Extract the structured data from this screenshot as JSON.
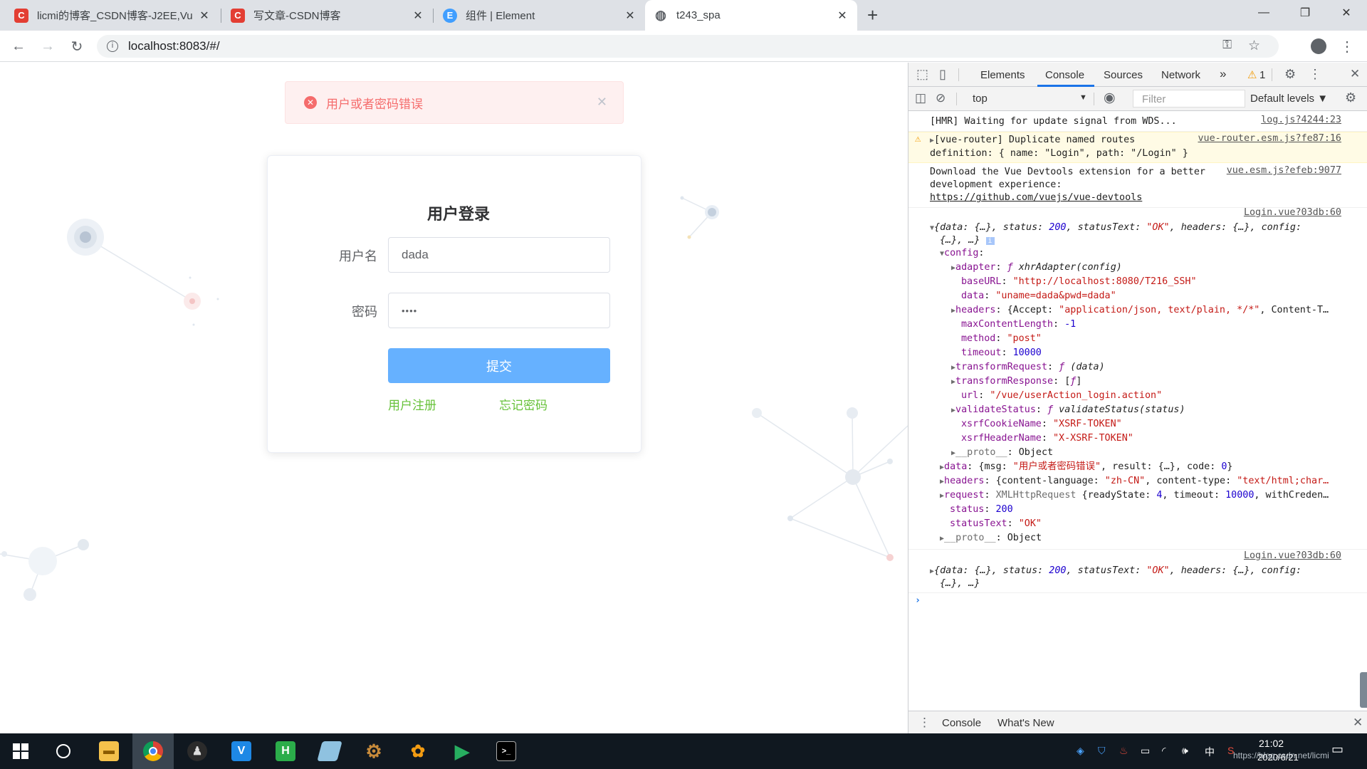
{
  "browser": {
    "tabs": [
      {
        "title": "licmi的博客_CSDN博客-J2EE,Vu",
        "favicon": "csdn-icon",
        "color": "#e33e33"
      },
      {
        "title": "写文章-CSDN博客",
        "favicon": "csdn-icon",
        "color": "#e33e33"
      },
      {
        "title": "组件 | Element",
        "favicon": "element-icon",
        "color": "#409eff"
      },
      {
        "title": "t243_spa",
        "favicon": "globe-icon",
        "color": "#5f6368"
      }
    ],
    "new_tab": "+",
    "address": "localhost:8083/#/"
  },
  "page": {
    "alert": {
      "message": "用户或者密码错误",
      "type": "error"
    },
    "login": {
      "title": "用户登录",
      "username_label": "用户名",
      "username_value": "dada",
      "password_label": "密码",
      "password_value": "••••",
      "submit": "提交",
      "register_link": "用户注册",
      "forgot_link": "忘记密码"
    }
  },
  "devtools": {
    "tabs": [
      "Elements",
      "Console",
      "Sources",
      "Network"
    ],
    "active_tab": "Console",
    "more": "»",
    "warning_count": "1",
    "context": "top",
    "filter_placeholder": "Filter",
    "levels": "Default levels ▼",
    "logs": {
      "hmr": "[HMR] Waiting for update signal from WDS...",
      "hmr_src": "log.js?4244:23",
      "warn1": "[vue-router] Duplicate named routes",
      "warn2": "definition: { name: \"Login\", path: \"/Login\" }",
      "warn_src": "vue-router.esm.js?fe87:16",
      "dev1": "Download the Vue Devtools extension for a better",
      "dev2": "development experience:",
      "dev_link": "https://github.com/vuejs/vue-devtools",
      "dev_src": "vue.esm.js?efeb:9077",
      "obj_src": "Login.vue?03db:60",
      "obj_src2": "Login.vue?03db:60"
    },
    "drawer_tabs": [
      "Console",
      "What's New"
    ]
  },
  "taskbar": {
    "time": "21:02",
    "date": "2020/6/21",
    "ime": "中",
    "watermark": "https://blog.csdn.net/licmi"
  }
}
